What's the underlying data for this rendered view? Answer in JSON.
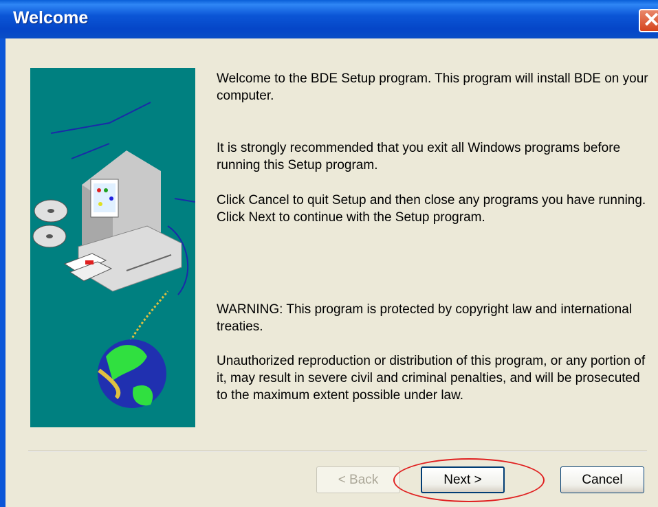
{
  "window": {
    "title": "Welcome"
  },
  "icons": {
    "close": "close-icon",
    "computer": "computer-icon",
    "globe": "globe-icon",
    "disc": "disc-icon",
    "floppy": "floppy-icon"
  },
  "body": {
    "p1": "Welcome to the BDE Setup program.  This program will install BDE on your computer.",
    "p2": "It is strongly recommended that you exit all Windows programs before running this Setup program.",
    "p3": "Click Cancel to quit Setup and then close any programs you have running.  Click Next to continue with the Setup program.",
    "p4": "WARNING: This program is protected by copyright law and international treaties.",
    "p5": "Unauthorized reproduction or distribution of this program, or any portion of it, may result in severe civil and criminal penalties, and will be prosecuted to the maximum extent possible under law."
  },
  "buttons": {
    "back": "< Back",
    "next": "Next >",
    "cancel": "Cancel"
  },
  "colors": {
    "titlebar": "#0a4ec6",
    "dialog_bg": "#ece9d8",
    "picture_bg": "#008080",
    "highlight": "#e02020"
  }
}
